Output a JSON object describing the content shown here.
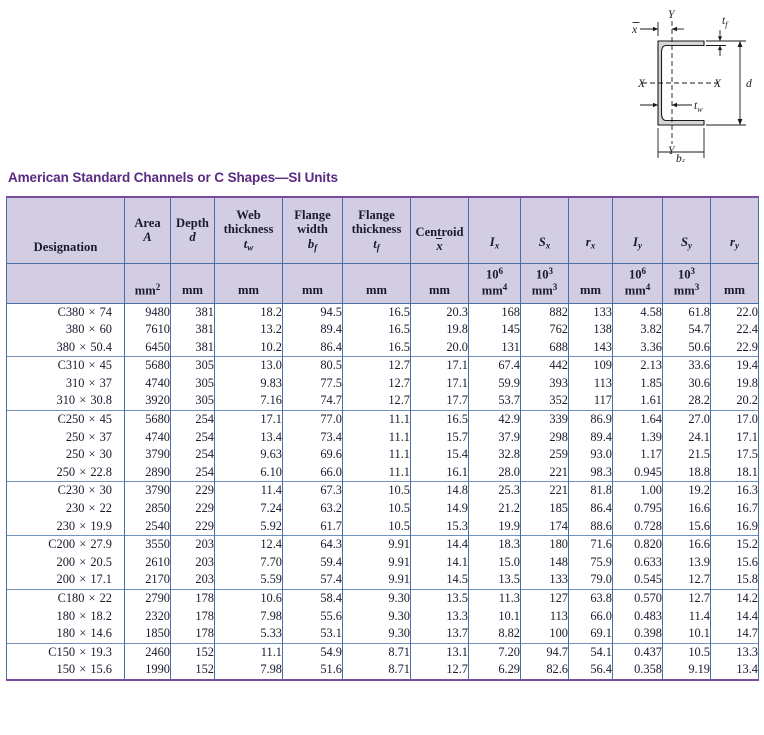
{
  "title": "American Standard Channels or C Shapes—SI Units",
  "colors": {
    "title": "#5b2a82",
    "header_bg": "#d3cde3",
    "rule": "#7a4d9e",
    "grid": "#4a6fa5",
    "group_sep": "#6f93bd",
    "figure_fill": "#d9d9d9"
  },
  "figure": {
    "name": "channel-cross-section",
    "labels": {
      "x_bar": "x̄",
      "y_top": "Y",
      "y_bottom": "Y",
      "x_left": "X",
      "x_right": "X",
      "t_f": "tf",
      "t_w": "tw",
      "d": "d",
      "b_f": "bf"
    }
  },
  "table": {
    "headers": [
      {
        "label": "Designation",
        "sym": "",
        "unit": ""
      },
      {
        "label": "Area",
        "sym": "A",
        "unit": "mm2"
      },
      {
        "label": "Depth",
        "sym": "d",
        "unit": "mm"
      },
      {
        "label": "Web thickness",
        "sym": "tw",
        "unit": "mm"
      },
      {
        "label": "Flange width",
        "sym": "bf",
        "unit": "mm"
      },
      {
        "label": "Flange thickness",
        "sym": "tf",
        "unit": "mm"
      },
      {
        "label": "Centroid",
        "sym": "x̄",
        "unit": "mm"
      },
      {
        "label": "",
        "sym": "Ix",
        "unit": "106 mm4"
      },
      {
        "label": "",
        "sym": "Sx",
        "unit": "103 mm3"
      },
      {
        "label": "",
        "sym": "rx",
        "unit": "mm"
      },
      {
        "label": "",
        "sym": "Iy",
        "unit": "106 mm4"
      },
      {
        "label": "",
        "sym": "Sy",
        "unit": "103 mm3"
      },
      {
        "label": "",
        "sym": "ry",
        "unit": "mm"
      }
    ],
    "header_text": {
      "designation": "Designation",
      "area": "Area",
      "depth": "Depth",
      "web": "Web",
      "thickness1": "thickness",
      "flange1": "Flange",
      "width": "width",
      "flange2": "Flange",
      "thickness2": "thickness",
      "centroid": "Centroid",
      "unit_mm": "mm",
      "unit_mm2": "mm",
      "unit_e6": "10",
      "unit_e3": "10"
    },
    "groups": [
      {
        "name": "C380",
        "rows": [
          {
            "designation_prefix": "C380",
            "designation_weight": "74",
            "area": "9480",
            "depth": "381",
            "tw": "18.2",
            "bf": "94.5",
            "tf": "16.5",
            "xbar": "20.3",
            "Ix": "168",
            "Sx": "882",
            "rx": "133",
            "Iy": "4.58",
            "Sy": "61.8",
            "ry": "22.0"
          },
          {
            "designation_prefix": "380",
            "designation_weight": "60",
            "area": "7610",
            "depth": "381",
            "tw": "13.2",
            "bf": "89.4",
            "tf": "16.5",
            "xbar": "19.8",
            "Ix": "145",
            "Sx": "762",
            "rx": "138",
            "Iy": "3.82",
            "Sy": "54.7",
            "ry": "22.4"
          },
          {
            "designation_prefix": "380",
            "designation_weight": "50.4",
            "area": "6450",
            "depth": "381",
            "tw": "10.2",
            "bf": "86.4",
            "tf": "16.5",
            "xbar": "20.0",
            "Ix": "131",
            "Sx": "688",
            "rx": "143",
            "Iy": "3.36",
            "Sy": "50.6",
            "ry": "22.9"
          }
        ]
      },
      {
        "name": "C310",
        "rows": [
          {
            "designation_prefix": "C310",
            "designation_weight": "45",
            "area": "5680",
            "depth": "305",
            "tw": "13.0",
            "bf": "80.5",
            "tf": "12.7",
            "xbar": "17.1",
            "Ix": "67.4",
            "Sx": "442",
            "rx": "109",
            "Iy": "2.13",
            "Sy": "33.6",
            "ry": "19.4"
          },
          {
            "designation_prefix": "310",
            "designation_weight": "37",
            "area": "4740",
            "depth": "305",
            "tw": "9.83",
            "bf": "77.5",
            "tf": "12.7",
            "xbar": "17.1",
            "Ix": "59.9",
            "Sx": "393",
            "rx": "113",
            "Iy": "1.85",
            "Sy": "30.6",
            "ry": "19.8"
          },
          {
            "designation_prefix": "310",
            "designation_weight": "30.8",
            "area": "3920",
            "depth": "305",
            "tw": "7.16",
            "bf": "74.7",
            "tf": "12.7",
            "xbar": "17.7",
            "Ix": "53.7",
            "Sx": "352",
            "rx": "117",
            "Iy": "1.61",
            "Sy": "28.2",
            "ry": "20.2"
          }
        ]
      },
      {
        "name": "C250",
        "rows": [
          {
            "designation_prefix": "C250",
            "designation_weight": "45",
            "area": "5680",
            "depth": "254",
            "tw": "17.1",
            "bf": "77.0",
            "tf": "11.1",
            "xbar": "16.5",
            "Ix": "42.9",
            "Sx": "339",
            "rx": "86.9",
            "Iy": "1.64",
            "Sy": "27.0",
            "ry": "17.0"
          },
          {
            "designation_prefix": "250",
            "designation_weight": "37",
            "area": "4740",
            "depth": "254",
            "tw": "13.4",
            "bf": "73.4",
            "tf": "11.1",
            "xbar": "15.7",
            "Ix": "37.9",
            "Sx": "298",
            "rx": "89.4",
            "Iy": "1.39",
            "Sy": "24.1",
            "ry": "17.1"
          },
          {
            "designation_prefix": "250",
            "designation_weight": "30",
            "area": "3790",
            "depth": "254",
            "tw": "9.63",
            "bf": "69.6",
            "tf": "11.1",
            "xbar": "15.4",
            "Ix": "32.8",
            "Sx": "259",
            "rx": "93.0",
            "Iy": "1.17",
            "Sy": "21.5",
            "ry": "17.5"
          },
          {
            "designation_prefix": "250",
            "designation_weight": "22.8",
            "area": "2890",
            "depth": "254",
            "tw": "6.10",
            "bf": "66.0",
            "tf": "11.1",
            "xbar": "16.1",
            "Ix": "28.0",
            "Sx": "221",
            "rx": "98.3",
            "Iy": "0.945",
            "Sy": "18.8",
            "ry": "18.1"
          }
        ]
      },
      {
        "name": "C230",
        "rows": [
          {
            "designation_prefix": "C230",
            "designation_weight": "30",
            "area": "3790",
            "depth": "229",
            "tw": "11.4",
            "bf": "67.3",
            "tf": "10.5",
            "xbar": "14.8",
            "Ix": "25.3",
            "Sx": "221",
            "rx": "81.8",
            "Iy": "1.00",
            "Sy": "19.2",
            "ry": "16.3"
          },
          {
            "designation_prefix": "230",
            "designation_weight": "22",
            "area": "2850",
            "depth": "229",
            "tw": "7.24",
            "bf": "63.2",
            "tf": "10.5",
            "xbar": "14.9",
            "Ix": "21.2",
            "Sx": "185",
            "rx": "86.4",
            "Iy": "0.795",
            "Sy": "16.6",
            "ry": "16.7"
          },
          {
            "designation_prefix": "230",
            "designation_weight": "19.9",
            "area": "2540",
            "depth": "229",
            "tw": "5.92",
            "bf": "61.7",
            "tf": "10.5",
            "xbar": "15.3",
            "Ix": "19.9",
            "Sx": "174",
            "rx": "88.6",
            "Iy": "0.728",
            "Sy": "15.6",
            "ry": "16.9"
          }
        ]
      },
      {
        "name": "C200",
        "rows": [
          {
            "designation_prefix": "C200",
            "designation_weight": "27.9",
            "area": "3550",
            "depth": "203",
            "tw": "12.4",
            "bf": "64.3",
            "tf": "9.91",
            "xbar": "14.4",
            "Ix": "18.3",
            "Sx": "180",
            "rx": "71.6",
            "Iy": "0.820",
            "Sy": "16.6",
            "ry": "15.2"
          },
          {
            "designation_prefix": "200",
            "designation_weight": "20.5",
            "area": "2610",
            "depth": "203",
            "tw": "7.70",
            "bf": "59.4",
            "tf": "9.91",
            "xbar": "14.1",
            "Ix": "15.0",
            "Sx": "148",
            "rx": "75.9",
            "Iy": "0.633",
            "Sy": "13.9",
            "ry": "15.6"
          },
          {
            "designation_prefix": "200",
            "designation_weight": "17.1",
            "area": "2170",
            "depth": "203",
            "tw": "5.59",
            "bf": "57.4",
            "tf": "9.91",
            "xbar": "14.5",
            "Ix": "13.5",
            "Sx": "133",
            "rx": "79.0",
            "Iy": "0.545",
            "Sy": "12.7",
            "ry": "15.8"
          }
        ]
      },
      {
        "name": "C180",
        "rows": [
          {
            "designation_prefix": "C180",
            "designation_weight": "22",
            "area": "2790",
            "depth": "178",
            "tw": "10.6",
            "bf": "58.4",
            "tf": "9.30",
            "xbar": "13.5",
            "Ix": "11.3",
            "Sx": "127",
            "rx": "63.8",
            "Iy": "0.570",
            "Sy": "12.7",
            "ry": "14.2"
          },
          {
            "designation_prefix": "180",
            "designation_weight": "18.2",
            "area": "2320",
            "depth": "178",
            "tw": "7.98",
            "bf": "55.6",
            "tf": "9.30",
            "xbar": "13.3",
            "Ix": "10.1",
            "Sx": "113",
            "rx": "66.0",
            "Iy": "0.483",
            "Sy": "11.4",
            "ry": "14.4"
          },
          {
            "designation_prefix": "180",
            "designation_weight": "14.6",
            "area": "1850",
            "depth": "178",
            "tw": "5.33",
            "bf": "53.1",
            "tf": "9.30",
            "xbar": "13.7",
            "Ix": "8.82",
            "Sx": "100",
            "rx": "69.1",
            "Iy": "0.398",
            "Sy": "10.1",
            "ry": "14.7"
          }
        ]
      },
      {
        "name": "C150",
        "rows": [
          {
            "designation_prefix": "C150",
            "designation_weight": "19.3",
            "area": "2460",
            "depth": "152",
            "tw": "11.1",
            "bf": "54.9",
            "tf": "8.71",
            "xbar": "13.1",
            "Ix": "7.20",
            "Sx": "94.7",
            "rx": "54.1",
            "Iy": "0.437",
            "Sy": "10.5",
            "ry": "13.3"
          },
          {
            "designation_prefix": "150",
            "designation_weight": "15.6",
            "area": "1990",
            "depth": "152",
            "tw": "7.98",
            "bf": "51.6",
            "tf": "8.71",
            "xbar": "12.7",
            "Ix": "6.29",
            "Sx": "82.6",
            "rx": "56.4",
            "Iy": "0.358",
            "Sy": "9.19",
            "ry": "13.4"
          }
        ]
      }
    ]
  }
}
